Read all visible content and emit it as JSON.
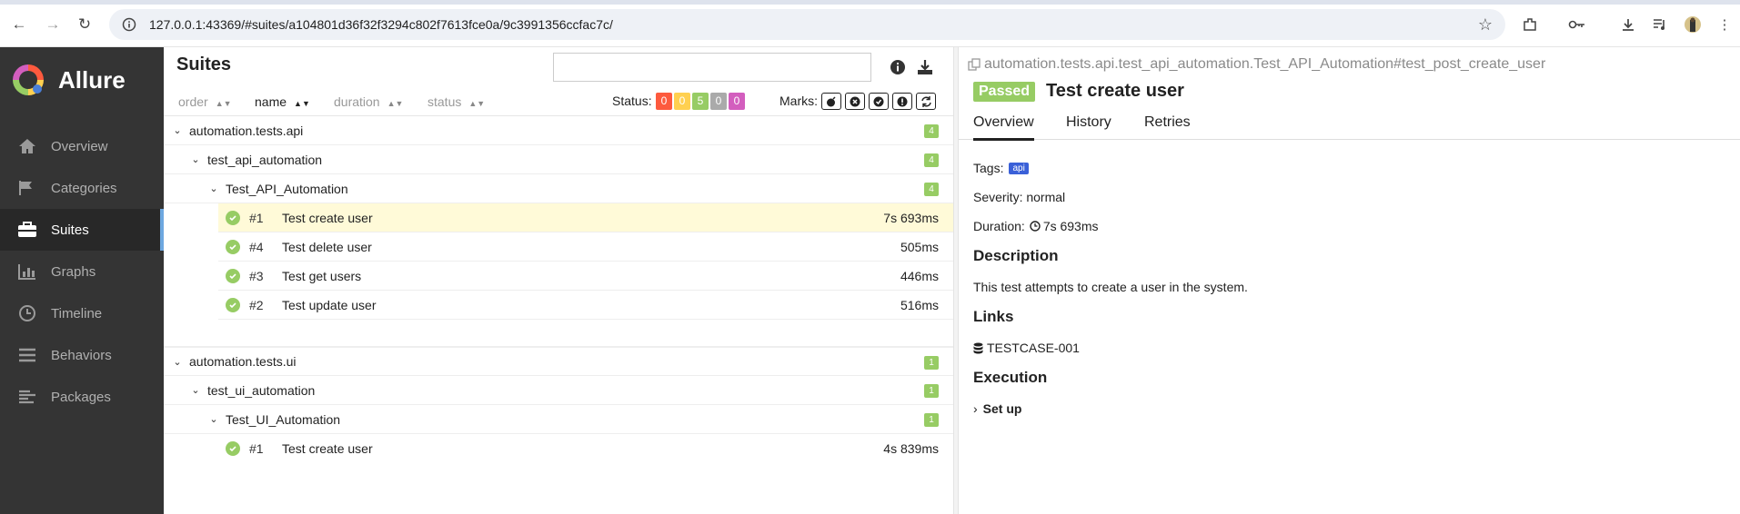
{
  "browser": {
    "url": "127.0.0.1:43369/#suites/a104801d36f32f3294c802f7613fce0a/9c3991356ccfac7c/"
  },
  "sidebar": {
    "brand": "Allure",
    "items": [
      {
        "label": "Overview",
        "icon": "home-icon"
      },
      {
        "label": "Categories",
        "icon": "flag-icon"
      },
      {
        "label": "Suites",
        "icon": "briefcase-icon"
      },
      {
        "label": "Graphs",
        "icon": "bar-chart-icon"
      },
      {
        "label": "Timeline",
        "icon": "clock-icon"
      },
      {
        "label": "Behaviors",
        "icon": "list-icon"
      },
      {
        "label": "Packages",
        "icon": "align-left-icon"
      }
    ],
    "active": "Suites"
  },
  "suites": {
    "title": "Suites",
    "search_value": "",
    "sort": {
      "order": "order",
      "name": "name",
      "duration": "duration",
      "status": "status"
    },
    "status_label": "Status:",
    "status_counts": [
      {
        "value": "0",
        "color": "#fd5a3e"
      },
      {
        "value": "0",
        "color": "#ffd050"
      },
      {
        "value": "5",
        "color": "#97cc64"
      },
      {
        "value": "0",
        "color": "#aaaaaa"
      },
      {
        "value": "0",
        "color": "#d35ebe"
      }
    ],
    "marks_label": "Marks:",
    "groups": [
      {
        "name": "automation.tests.api",
        "count": "4",
        "module": "test_api_automation",
        "module_count": "4",
        "cls": "Test_API_Automation",
        "cls_count": "4",
        "tests": [
          {
            "num": "#1",
            "name": "Test create user",
            "duration": "7s 693ms"
          },
          {
            "num": "#4",
            "name": "Test delete user",
            "duration": "505ms"
          },
          {
            "num": "#3",
            "name": "Test get users",
            "duration": "446ms"
          },
          {
            "num": "#2",
            "name": "Test update user",
            "duration": "516ms"
          }
        ]
      },
      {
        "name": "automation.tests.ui",
        "count": "1",
        "module": "test_ui_automation",
        "module_count": "1",
        "cls": "Test_UI_Automation",
        "cls_count": "1",
        "tests": [
          {
            "num": "#1",
            "name": "Test create user",
            "duration": "4s 839ms"
          }
        ]
      }
    ]
  },
  "details": {
    "path": "automation.tests.api.test_api_automation.Test_API_Automation#test_post_create_user",
    "status": "Passed",
    "name": "Test create user",
    "tabs": [
      "Overview",
      "History",
      "Retries"
    ],
    "tags_label": "Tags:",
    "tag": "api",
    "severity": "Severity: normal",
    "duration_label": "Duration:",
    "duration": "7s 693ms",
    "description_title": "Description",
    "description": "This test attempts to create a user in the system.",
    "links_title": "Links",
    "link": "TESTCASE-001",
    "execution_title": "Execution",
    "setup": "Set up"
  }
}
